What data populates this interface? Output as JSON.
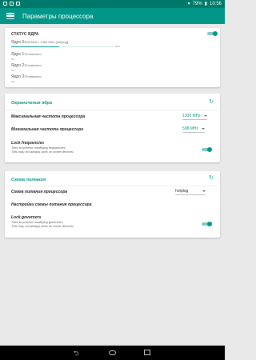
{
  "statusbar": {
    "battery": "79%",
    "time": "10:56"
  },
  "appbar": {
    "title": "Параметры процессора"
  },
  "core_status": {
    "title": "СТАТУС ЯДРА",
    "cores": [
      {
        "name": "Ядро 0:",
        "value": "598 MHz / 1300 MHz [hotplug]",
        "percent": 46,
        "percent_end_label": "46%",
        "percent_label": "0%"
      },
      {
        "name": "Ядро 1:",
        "value": "Отключено",
        "percent": 0,
        "percent_label": "0%"
      },
      {
        "name": "Ядро 2:",
        "value": "Отключено",
        "percent": 0,
        "percent_label": "0%"
      },
      {
        "name": "Ядро 3:",
        "value": "Отключено",
        "percent": 0,
        "percent_label": "0%"
      }
    ]
  },
  "core_limits": {
    "title": "Ограничения ядра",
    "max_freq_label": "Максимальная частота процессора",
    "max_freq_value": "1300 MHz",
    "min_freq_label": "Минимальная частота процессора",
    "min_freq_value": "598 MHz",
    "lock_freq_label": "Lock frequencies",
    "lock_freq_sub1": "Tries to prevent modifying frequencies",
    "lock_freq_sub2": "This may not always work on some devices!"
  },
  "power_scheme": {
    "title": "Схема питания",
    "governor_label": "Схема питания процессора",
    "governor_value": "hotplug",
    "governor_settings_label": "Настройки схемы питания процессора",
    "lock_gov_label": "Lock governors",
    "lock_gov_sub1": "Tries to prevent modifying governors",
    "lock_gov_sub2": "This may not always work on some devices!"
  },
  "colors": {
    "primary": "#009688",
    "primary_dark": "#00796b",
    "accent_light": "#80cbc4"
  }
}
